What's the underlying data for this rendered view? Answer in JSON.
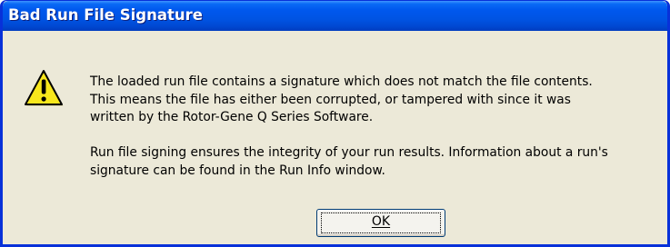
{
  "window": {
    "title": "Bad Run File Signature"
  },
  "icon": {
    "name": "warning-icon",
    "color": "#f8e71c"
  },
  "message": {
    "paragraph1": [
      "The loaded run file contains a signature which does not match the file contents.",
      "This means the file has either been corrupted, or tampered with since it was",
      "written by the Rotor-Gene Q Series Software."
    ],
    "paragraph2": [
      "Run file signing ensures the integrity of your run results. Information about a run's",
      "signature can be found in the Run Info window."
    ]
  },
  "buttons": {
    "ok_label": "OK"
  },
  "colors": {
    "titlebar": "#0054e3",
    "dialog_background": "#ece9d8",
    "border": "#0831d9"
  }
}
